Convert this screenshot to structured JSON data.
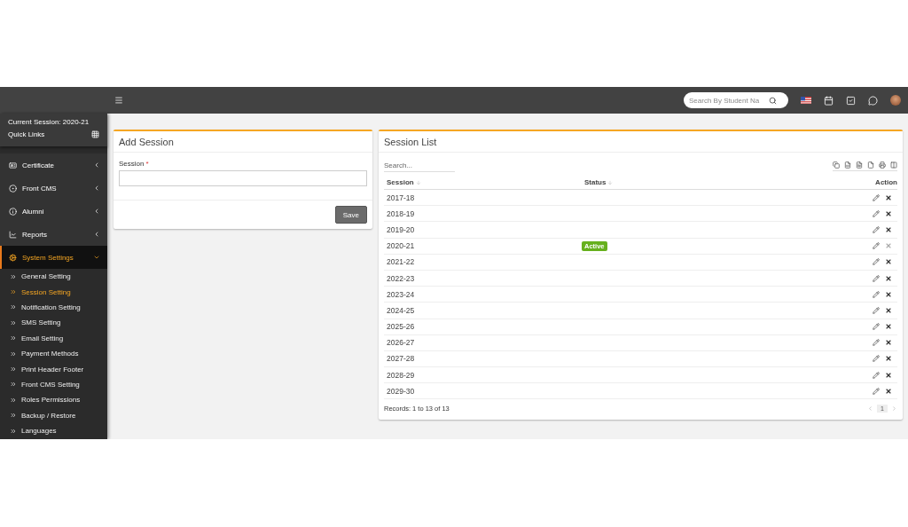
{
  "topbar": {
    "search": {
      "placeholder": "Search By Student Na"
    }
  },
  "sidebar": {
    "current_session": "Current Session: 2020-21",
    "quick_links": "Quick Links",
    "items": [
      {
        "label": "Certificate",
        "expanded": false,
        "selected": false
      },
      {
        "label": "Front CMS",
        "expanded": false,
        "selected": false
      },
      {
        "label": "Alumni",
        "expanded": false,
        "selected": false
      },
      {
        "label": "Reports",
        "expanded": false,
        "selected": false
      },
      {
        "label": "System Settings",
        "expanded": true,
        "selected": true,
        "children": [
          {
            "label": "General Setting",
            "selected": false
          },
          {
            "label": "Session Setting",
            "selected": true
          },
          {
            "label": "Notification Setting",
            "selected": false
          },
          {
            "label": "SMS Setting",
            "selected": false
          },
          {
            "label": "Email Setting",
            "selected": false
          },
          {
            "label": "Payment Methods",
            "selected": false
          },
          {
            "label": "Print Header Footer",
            "selected": false
          },
          {
            "label": "Front CMS Setting",
            "selected": false
          },
          {
            "label": "Roles Permissions",
            "selected": false
          },
          {
            "label": "Backup / Restore",
            "selected": false
          },
          {
            "label": "Languages",
            "selected": false
          }
        ]
      }
    ]
  },
  "add_session": {
    "title": "Add Session",
    "field_label": "Session",
    "required_mark": "*",
    "save": "Save"
  },
  "session_list": {
    "title": "Session List",
    "search": {
      "placeholder": "Search..."
    },
    "columns": [
      "Session",
      "Status",
      "Action"
    ],
    "rows": [
      {
        "session": "2017-18",
        "delete_disabled": false
      },
      {
        "session": "2018-19",
        "delete_disabled": false
      },
      {
        "session": "2019-20",
        "delete_disabled": false
      },
      {
        "session": "2020-21",
        "status": "Active",
        "delete_disabled": true
      },
      {
        "session": "2021-22",
        "delete_disabled": false
      },
      {
        "session": "2022-23",
        "delete_disabled": false
      },
      {
        "session": "2023-24",
        "delete_disabled": false
      },
      {
        "session": "2024-25",
        "delete_disabled": false
      },
      {
        "session": "2025-26",
        "delete_disabled": false
      },
      {
        "session": "2026-27",
        "delete_disabled": false
      },
      {
        "session": "2027-28",
        "delete_disabled": false
      },
      {
        "session": "2028-29",
        "delete_disabled": false
      },
      {
        "session": "2029-30",
        "delete_disabled": false
      }
    ],
    "records": "Records: 1 to 13 of 13",
    "page": "1"
  }
}
